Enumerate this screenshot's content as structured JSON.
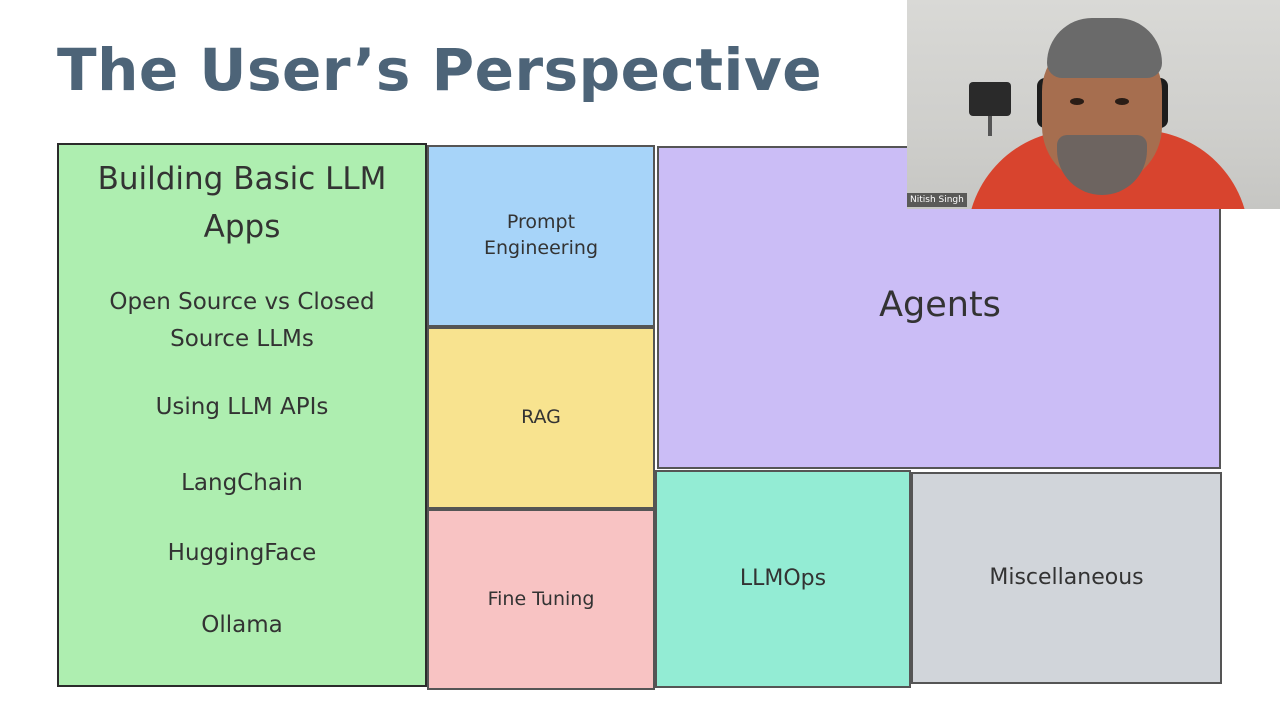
{
  "slide": {
    "title": "The User’s Perspective",
    "basic_apps": {
      "heading_line1": "Building Basic LLM",
      "heading_line2": "Apps",
      "items": [
        {
          "line1": "Open Source vs Closed",
          "line2": "Source LLMs"
        },
        {
          "line1": "Using LLM APIs"
        },
        {
          "line1": "LangChain"
        },
        {
          "line1": "HuggingFace"
        },
        {
          "line1": "Ollama"
        }
      ]
    },
    "tiles": {
      "prompt_line1": "Prompt",
      "prompt_line2": "Engineering",
      "rag": "RAG",
      "fine_tuning": "Fine Tuning",
      "agents": "Agents",
      "llmops": "LLMOps",
      "misc": "Miscellaneous"
    },
    "colors": {
      "title": "#4d6478",
      "green": "#aeeeb0",
      "blue": "#a7d4f9",
      "yellow": "#f8e38f",
      "pink": "#f8c3c3",
      "purple": "#cbbdf6",
      "teal": "#93ecd4",
      "gray": "#d1d5da"
    }
  },
  "webcam": {
    "name": "Nitish Singh"
  }
}
